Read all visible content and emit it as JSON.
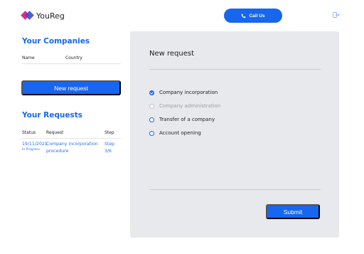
{
  "header": {
    "app_name": "YouReg",
    "call_label": "Call Us",
    "logo_colors": [
      "#d52f8a",
      "#3f4fd8"
    ],
    "accent": "#1766f0"
  },
  "companies": {
    "title": "Your Companies",
    "columns": [
      "Name",
      "Country"
    ],
    "new_request_label": "New request"
  },
  "requests": {
    "title": "Your Requests",
    "columns": [
      "Status",
      "Request",
      "Step"
    ],
    "rows": [
      {
        "date": "19/11/2021",
        "status": "In Progress",
        "request_line1": "Company incorporation",
        "request_line2": "procedure",
        "step_line1": "Step",
        "step_line2": "3/6"
      }
    ]
  },
  "form": {
    "title": "New request",
    "options": [
      {
        "label": "Company incorporation",
        "selected": true,
        "disabled": false
      },
      {
        "label": "Company administration",
        "selected": false,
        "disabled": true
      },
      {
        "label": "Transfer of a company",
        "selected": false,
        "disabled": false
      },
      {
        "label": "Account opening",
        "selected": false,
        "disabled": false
      }
    ],
    "submit_label": "Submit"
  }
}
